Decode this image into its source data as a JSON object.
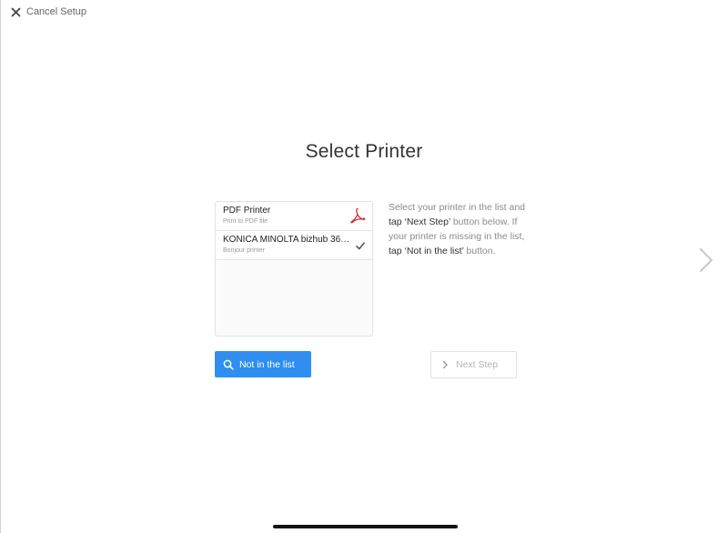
{
  "header": {
    "cancel_label": "Cancel Setup"
  },
  "title": "Select Printer",
  "printers": [
    {
      "name": "PDF Printer",
      "subtitle": "Print to PDF file",
      "icon": "pdf-icon"
    },
    {
      "name": "KONICA MINOLTA bizhub 363(…",
      "subtitle": "Bonjour printer",
      "icon": "checkmark-icon",
      "selected": true
    }
  ],
  "instructions": {
    "part1": "Select your printer in the list and ",
    "part2": "tap ‘Next Step’",
    "part3": " button below. If your printer is missing in the list, ",
    "part4": "tap ‘Not in the list’",
    "part5": " button."
  },
  "buttons": {
    "not_in_list": "Not in the list",
    "next_step": "Next Step"
  },
  "colors": {
    "accent": "#2f8ef0",
    "pdf_red": "#d22b2b",
    "disabled_text": "#b4b4b4"
  }
}
